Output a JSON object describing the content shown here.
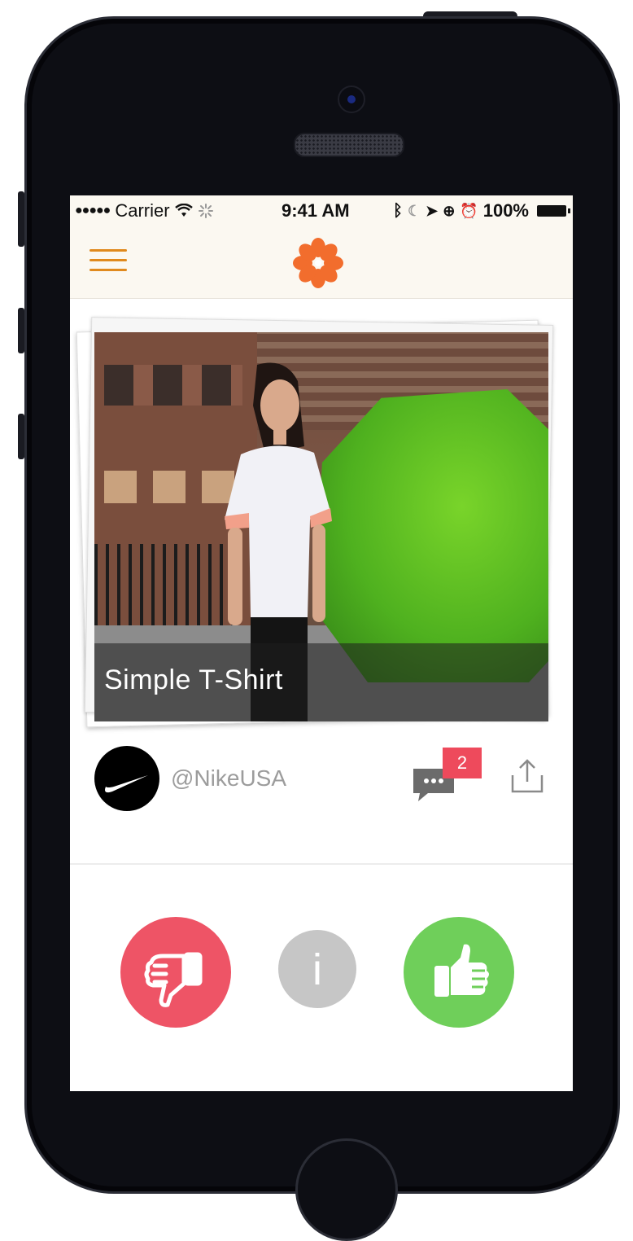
{
  "status_bar": {
    "signal": "●●●●●",
    "carrier": "Carrier",
    "time": "9:41 AM",
    "battery": "100%"
  },
  "nav": {
    "menu_icon": "hamburger-icon",
    "logo_icon": "flower-logo-icon"
  },
  "card": {
    "title": "Simple T-Shirt"
  },
  "meta": {
    "handle": "@NikeUSA",
    "comment_count": "2",
    "avatar_icon": "nike-swoosh-icon",
    "share_icon": "share-icon",
    "comment_icon": "comment-icon"
  },
  "actions": {
    "dislike_icon": "thumbs-down-icon",
    "info_label": "i",
    "like_icon": "thumbs-up-icon"
  },
  "colors": {
    "accent_orange": "#f26d2d",
    "menu_orange": "#e08a1e",
    "dislike_red": "#ee5466",
    "like_green": "#6fcf5a",
    "info_gray": "#c6c6c6",
    "badge_red": "#ee4a5c"
  }
}
